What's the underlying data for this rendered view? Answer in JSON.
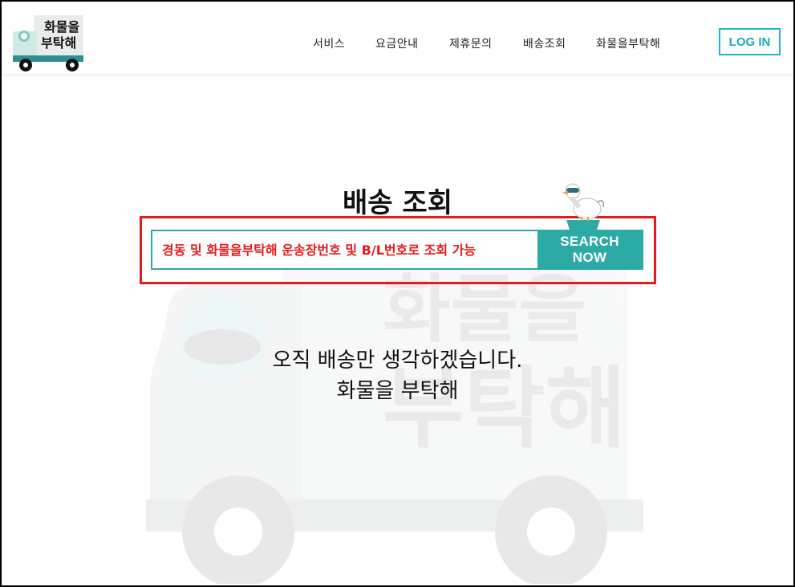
{
  "header": {
    "logo_text_line1": "화물을",
    "logo_text_line2": "부탁해",
    "nav": [
      "서비스",
      "요금안내",
      "제휴문의",
      "배송조회",
      "화물을부탁해"
    ],
    "login_label": "LOG IN"
  },
  "main": {
    "title": "배송 조회",
    "search": {
      "placeholder": "경동 및 화물을부탁해 운송장번호 및 B/L번호로 조회 가능",
      "button_label": "SEARCH NOW"
    },
    "tagline_line1": "오직 배송만 생각하겠습니다.",
    "tagline_line2": "화물을 부탁해",
    "watermark_text_line1": "화물을",
    "watermark_text_line2": "부탁해"
  },
  "colors": {
    "accent": "#2baaa6",
    "login_border": "#22b5c9",
    "highlight": "#e31b1b"
  },
  "icons": {
    "logo": "delivery-truck-logo",
    "mascot": "seagull-mascot-icon"
  }
}
